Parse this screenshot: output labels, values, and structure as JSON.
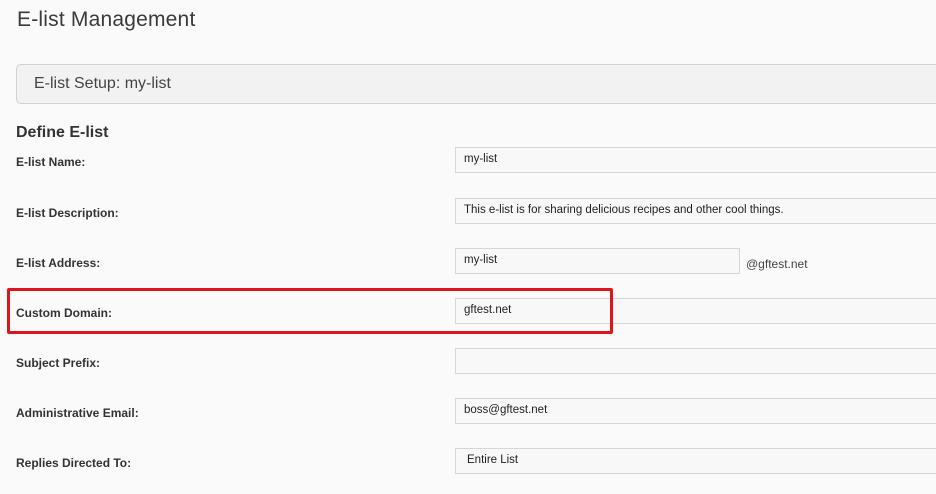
{
  "header": {
    "title": "E-list Management"
  },
  "setup": {
    "title": "E-list Setup: my-list"
  },
  "form": {
    "section_title": "Define E-list",
    "name": {
      "label": "E-list Name:",
      "value": "my-list"
    },
    "description": {
      "label": "E-list Description:",
      "value": "This e-list is for sharing delicious recipes and other cool things."
    },
    "address": {
      "label": "E-list Address:",
      "value": "my-list",
      "suffix": "@gftest.net"
    },
    "custom_domain": {
      "label": "Custom Domain:",
      "value": "gftest.net"
    },
    "subject_prefix": {
      "label": "Subject Prefix:",
      "value": ""
    },
    "admin_email": {
      "label": "Administrative Email:",
      "value": "boss@gftest.net"
    },
    "replies_to": {
      "label": "Replies Directed To:",
      "value": "Entire List"
    }
  },
  "colors": {
    "highlight": "#e0141b"
  }
}
